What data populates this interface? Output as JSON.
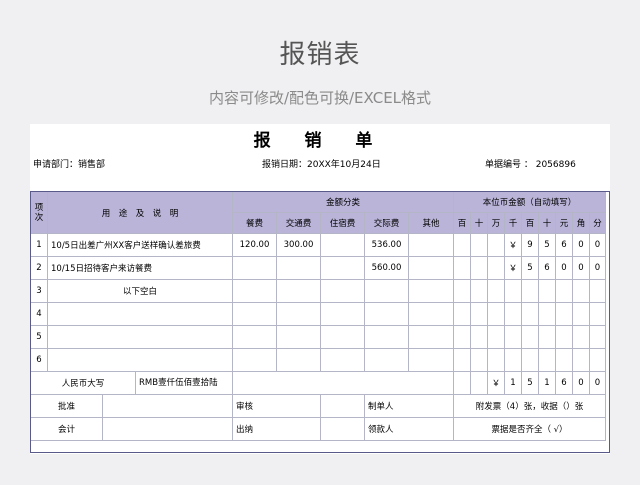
{
  "page": {
    "title": "报销表",
    "subtitle": "内容可修改/配色可换/EXCEL格式"
  },
  "form": {
    "title": "报 销 单",
    "dept": "申请部门：销售部",
    "date": "报销日期：20XX年10月24日",
    "number": "单据编号 ： 2056896"
  },
  "header": {
    "item_no": "项次",
    "purpose": "用　途　及　说　明",
    "amount_group": "金额分类",
    "categories": [
      "餐费",
      "交通费",
      "住宿费",
      "交际费",
      "其他"
    ],
    "currency_group": "本位币金额（自动填写）",
    "digits": [
      "百",
      "十",
      "万",
      "千",
      "百",
      "十",
      "元",
      "角",
      "分"
    ]
  },
  "rows": [
    {
      "no": "1",
      "desc": "10/5日出差广州XX客户送样确认差旅费",
      "amounts": [
        "120.00",
        "300.00",
        "",
        "536.00",
        ""
      ],
      "digits": [
        "",
        "",
        "",
        "￥",
        "9",
        "5",
        "6",
        "0",
        "0"
      ]
    },
    {
      "no": "2",
      "desc": "10/15日招待客户来访餐费",
      "amounts": [
        "",
        "",
        "",
        "560.00",
        ""
      ],
      "digits": [
        "",
        "",
        "",
        "￥",
        "5",
        "6",
        "0",
        "0",
        "0"
      ]
    },
    {
      "no": "3",
      "desc": "以下空白",
      "amounts": [
        "",
        "",
        "",
        "",
        ""
      ],
      "digits": [
        "",
        "",
        "",
        "",
        "",
        "",
        "",
        "",
        ""
      ]
    },
    {
      "no": "4",
      "desc": "",
      "amounts": [
        "",
        "",
        "",
        "",
        ""
      ],
      "digits": [
        "",
        "",
        "",
        "",
        "",
        "",
        "",
        "",
        ""
      ]
    },
    {
      "no": "5",
      "desc": "",
      "amounts": [
        "",
        "",
        "",
        "",
        ""
      ],
      "digits": [
        "",
        "",
        "",
        "",
        "",
        "",
        "",
        "",
        ""
      ]
    },
    {
      "no": "6",
      "desc": "",
      "amounts": [
        "",
        "",
        "",
        "",
        ""
      ],
      "digits": [
        "",
        "",
        "",
        "",
        "",
        "",
        "",
        "",
        ""
      ]
    }
  ],
  "total": {
    "label": "人民币大写",
    "text": "RMB壹仟伍佰壹拾陆",
    "digits": [
      "",
      "",
      "￥",
      "1",
      "5",
      "1",
      "6",
      "0",
      "0"
    ]
  },
  "signoff": {
    "approve": "批准",
    "review": "审核",
    "maker": "制单人",
    "attach": "附发票（4）张，收据（）张",
    "accountant": "会计",
    "cashier": "出纳",
    "receiver": "领款人",
    "complete": "票据是否齐全（ √）"
  }
}
